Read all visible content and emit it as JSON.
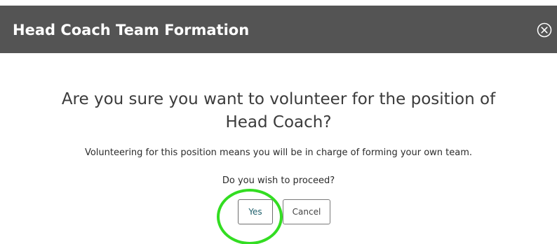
{
  "dialog": {
    "title": "Head Coach Team Formation",
    "close_icon": "close-circle-icon",
    "question_line1": "Are you sure you want to volunteer for the position of",
    "question_line2": "Head Coach?",
    "description": "Volunteering for this position means you will be in charge of forming your own team.",
    "proceed_prompt": "Do you wish to proceed?",
    "buttons": {
      "yes_label": "Yes",
      "cancel_label": "Cancel"
    }
  },
  "colors": {
    "header_background": "#545454",
    "header_text": "#ffffff",
    "yes_text": "#1e5f6b",
    "highlight_annotation": "#33dd22"
  }
}
